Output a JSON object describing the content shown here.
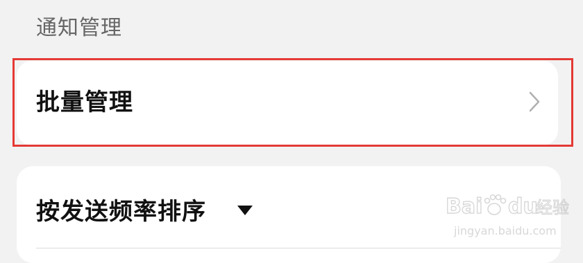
{
  "section": {
    "title": "通知管理"
  },
  "batch_manage": {
    "label": "批量管理",
    "icon": "chevron-right-icon"
  },
  "sort": {
    "label": "按发送频率排序",
    "icon": "caret-down-icon"
  },
  "watermark": {
    "logo_text": "Bai du 经验",
    "url": "jingyan.baidu.com"
  },
  "colors": {
    "background": "#f2f2f2",
    "card": "#ffffff",
    "highlight": "#e53935",
    "text_primary": "#111111",
    "text_secondary": "#666666"
  }
}
